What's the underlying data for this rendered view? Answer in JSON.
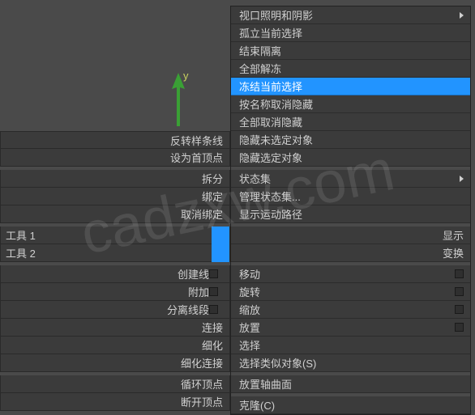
{
  "axis": {
    "label": "y"
  },
  "left_panel": {
    "group1": [
      "反转样条线",
      "设为首顶点"
    ],
    "group2": [
      "拆分",
      "绑定",
      "取消绑定"
    ],
    "tools": [
      {
        "label": "工具 1",
        "right": "显示"
      },
      {
        "label": "工具 2",
        "right": "变换"
      }
    ],
    "group3": [
      "创建线",
      "附加",
      "分离线段",
      "连接",
      "细化",
      "细化连接"
    ],
    "group4": [
      "循环顶点",
      "断开顶点"
    ]
  },
  "context_menu": {
    "items1": [
      {
        "label": "视口照明和阴影",
        "sub": true
      },
      {
        "label": "孤立当前选择"
      },
      {
        "label": "结束隔离"
      },
      {
        "label": "全部解冻"
      },
      {
        "label": "冻结当前选择",
        "selected": true
      },
      {
        "label": "按名称取消隐藏"
      },
      {
        "label": "全部取消隐藏"
      },
      {
        "label": "隐藏未选定对象"
      },
      {
        "label": "隐藏选定对象"
      }
    ],
    "items2": [
      {
        "label": "状态集",
        "sub": true
      },
      {
        "label": "管理状态集..."
      },
      {
        "label": "显示运动路径"
      }
    ],
    "items3": [
      {
        "label": "移动",
        "check": true
      },
      {
        "label": "旋转",
        "check": true
      },
      {
        "label": "缩放",
        "check": true
      },
      {
        "label": "放置",
        "check": true
      },
      {
        "label": "选择"
      },
      {
        "label": "选择类似对象(S)"
      }
    ],
    "items4": [
      {
        "label": "放置轴曲面"
      }
    ],
    "items5": [
      {
        "label": "克隆(C)"
      }
    ]
  },
  "watermark": "cadzxw.com"
}
